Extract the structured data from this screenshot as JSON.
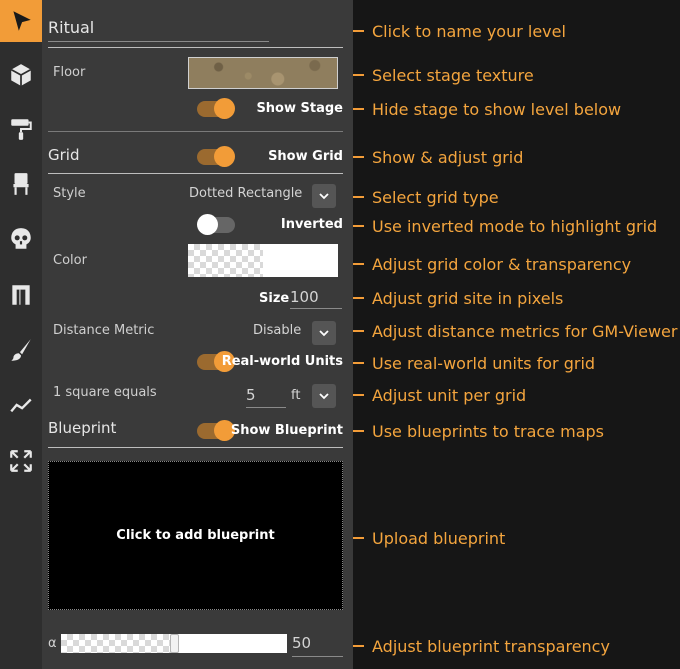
{
  "toolbar": {
    "tools": [
      "pointer-icon",
      "cube-icon",
      "paint-roller-icon",
      "chair-icon",
      "skull-icon",
      "wall-icon",
      "brush-icon",
      "line-graph-icon",
      "expand-icon"
    ]
  },
  "level": {
    "name": "Ritual"
  },
  "floor": {
    "label": "Floor",
    "show_stage_label": "Show Stage"
  },
  "grid": {
    "heading": "Grid",
    "show_grid_label": "Show Grid",
    "style_label": "Style",
    "style_value": "Dotted Rectangle",
    "inverted_label": "Inverted",
    "color_label": "Color",
    "size_label": "Size",
    "size_value": "100",
    "distance_metric_label": "Distance Metric",
    "distance_metric_value": "Disable",
    "real_world_label": "Real-world Units",
    "square_equals_label": "1 square equals",
    "square_value": "5",
    "unit_value": "ft"
  },
  "blueprint": {
    "heading": "Blueprint",
    "show_label": "Show Blueprint",
    "dropzone_label": "Click to add blueprint",
    "alpha_label": "α",
    "alpha_value": "50",
    "alpha_fraction": 0.5
  },
  "toggles": {
    "show_stage": true,
    "show_grid": true,
    "inverted": false,
    "real_world_units": true,
    "show_blueprint": true
  },
  "callouts": [
    "Click to name your level",
    "Select stage texture",
    "Hide stage to show level below",
    "Show & adjust grid",
    "Select grid type",
    "Use inverted mode to highlight grid",
    "Adjust grid color & transparency",
    "Adjust grid site in pixels",
    "Adjust distance metrics for GM-Viewer",
    "Use real-world units for grid",
    "Adjust unit per grid",
    "Use blueprints to trace maps",
    "Upload blueprint",
    "Adjust blueprint transparency"
  ],
  "colors": {
    "accent": "#f29c38",
    "panel": "#3a3a3a",
    "toolbar": "#2e2e2e",
    "background": "#161616"
  }
}
